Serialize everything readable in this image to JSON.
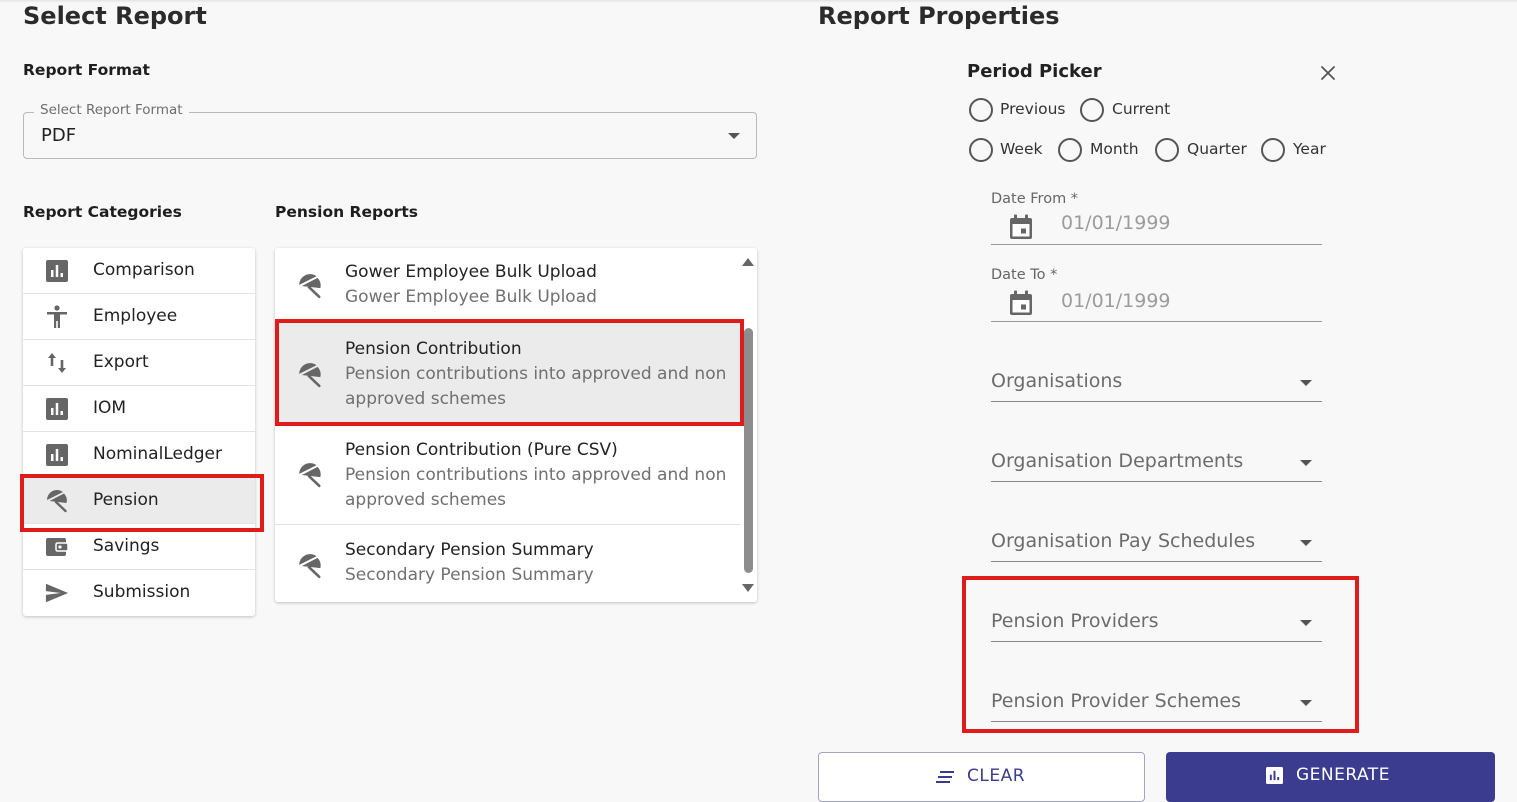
{
  "left": {
    "title": "Select Report",
    "format_heading": "Report Format",
    "format_legend": "Select Report Format",
    "format_value": "PDF",
    "categories_heading": "Report Categories",
    "categories": [
      {
        "label": "Comparison",
        "icon": "bar-chart-icon"
      },
      {
        "label": "Employee",
        "icon": "person-icon"
      },
      {
        "label": "Export",
        "icon": "swap-vertical-icon"
      },
      {
        "label": "IOM",
        "icon": "bar-chart-icon"
      },
      {
        "label": "NominalLedger",
        "icon": "bar-chart-icon"
      },
      {
        "label": "Pension",
        "icon": "umbrella-icon",
        "selected": true
      },
      {
        "label": "Savings",
        "icon": "wallet-icon"
      },
      {
        "label": "Submission",
        "icon": "send-icon"
      }
    ],
    "reports_heading": "Pension Reports",
    "reports": [
      {
        "title": "Gower Employee Bulk Upload",
        "desc": "Gower Employee Bulk Upload"
      },
      {
        "title": "Pension Contribution",
        "desc": "Pension contributions into approved and non approved schemes",
        "selected": true
      },
      {
        "title": "Pension Contribution (Pure CSV)",
        "desc": "Pension contributions into approved and non approved schemes"
      },
      {
        "title": "Secondary Pension Summary",
        "desc": "Secondary Pension Summary"
      }
    ]
  },
  "right": {
    "title": "Report Properties",
    "period_picker": {
      "title": "Period Picker",
      "options_row1": [
        "Previous",
        "Current"
      ],
      "options_row2": [
        "Week",
        "Month",
        "Quarter",
        "Year"
      ]
    },
    "date_from": {
      "label": "Date From *",
      "value": "01/01/1999"
    },
    "date_to": {
      "label": "Date To *",
      "value": "01/01/1999"
    },
    "selects": [
      "Organisations",
      "Organisation Departments",
      "Organisation Pay Schedules",
      "Pension Providers",
      "Pension Provider Schemes"
    ]
  },
  "buttons": {
    "clear": "CLEAR",
    "generate": "GENERATE"
  },
  "colors": {
    "highlight": "#e01b1b",
    "primary": "#3b3b8f",
    "icon": "#666666"
  }
}
